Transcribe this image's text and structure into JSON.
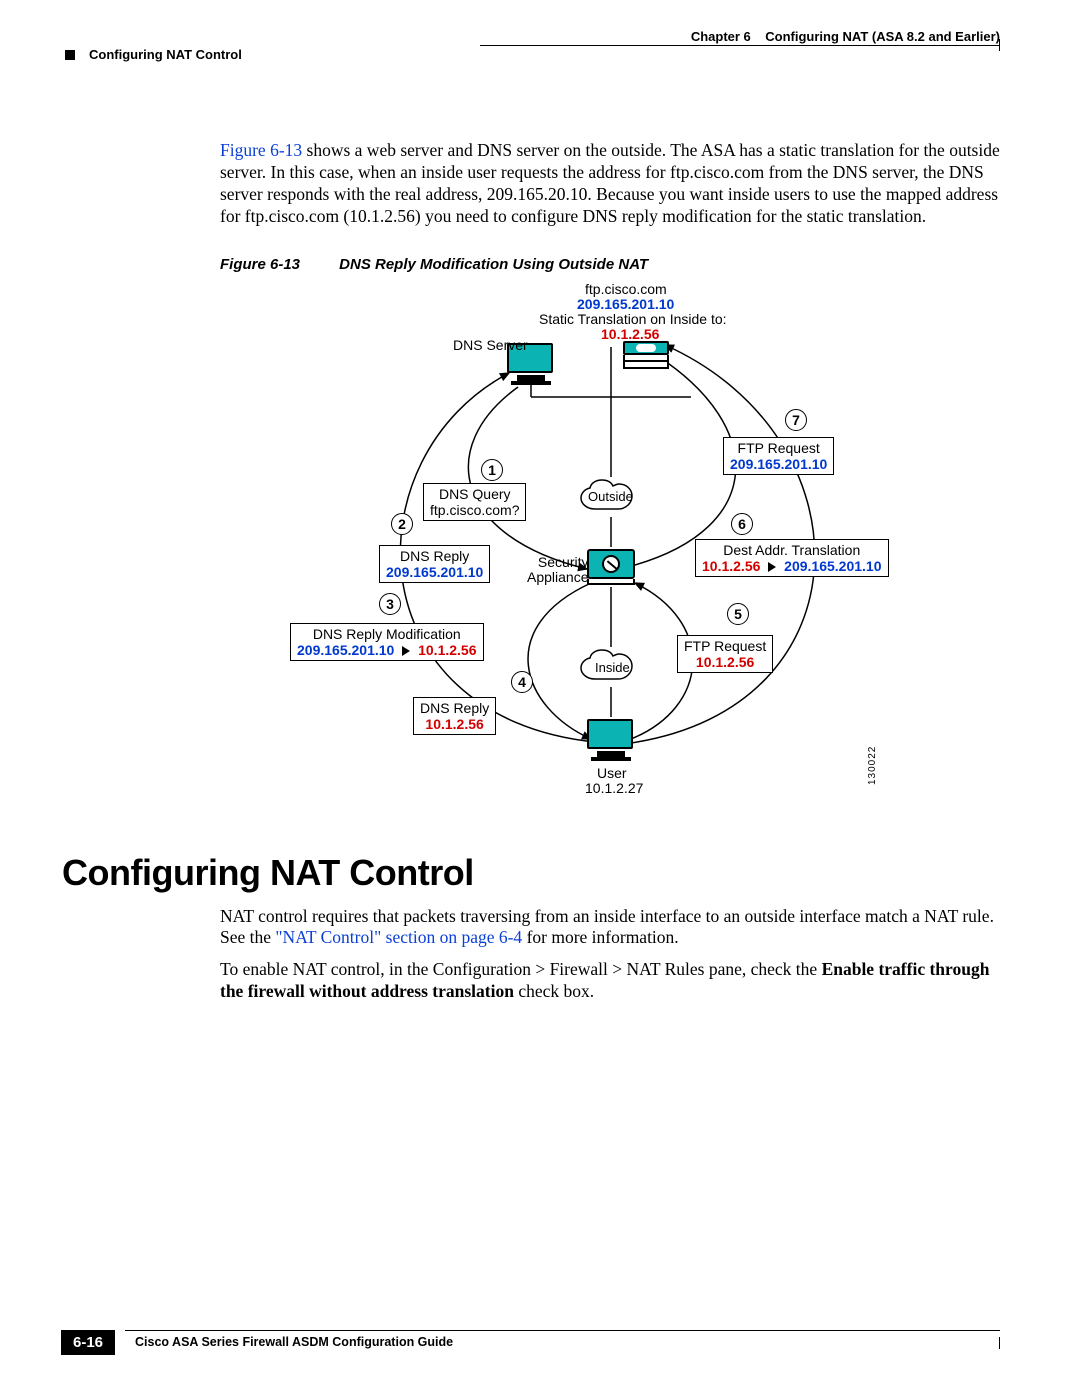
{
  "header": {
    "chapter": "Chapter 6",
    "chapter_title": "Configuring NAT (ASA 8.2 and Earlier)",
    "section": "Configuring NAT Control"
  },
  "intro": {
    "figref": "Figure 6-13",
    "text_after_ref": " shows a web server and DNS server on the outside. The ASA has a static translation for the outside server. In this case, when an inside user requests the address for ftp.cisco.com from the DNS server, the DNS server responds with the real address, 209.165.20.10. Because you want inside users to use the mapped address for ftp.cisco.com (10.1.2.56) you need to configure DNS reply modification for the static translation."
  },
  "figure": {
    "num": "Figure 6-13",
    "title": "DNS Reply Modification Using Outside NAT",
    "diagram_id": "130022",
    "labels": {
      "ftp_host": "ftp.cisco.com",
      "ftp_ip": "209.165.201.10",
      "static_xlate": "Static Translation on Inside to:",
      "static_ip": "10.1.2.56",
      "dns_server": "DNS Server",
      "outside": "Outside",
      "inside": "Inside",
      "sec_app": "Security\nAppliance",
      "user": "User",
      "user_ip": "10.1.2.27",
      "b1_l1": "DNS Query",
      "b1_l2": "ftp.cisco.com?",
      "b2_l1": "DNS Reply",
      "b2_ip": "209.165.201.10",
      "b3_l1": "DNS Reply Modification",
      "b3_from": "209.165.201.10",
      "b3_to": "10.1.2.56",
      "b4_l1": "DNS Reply",
      "b4_ip": "10.1.2.56",
      "b5_l1": "FTP Request",
      "b5_ip": "10.1.2.56",
      "b6_l1": "Dest Addr. Translation",
      "b6_from": "10.1.2.56",
      "b6_to": "209.165.201.10",
      "b7_l1": "FTP Request",
      "b7_ip": "209.165.201.10"
    }
  },
  "heading": "Configuring NAT Control",
  "p1_pre": "NAT control requires that packets traversing from an inside interface to an outside interface match a NAT rule. See the ",
  "p1_link": "\"NAT Control\" section on page 6-4",
  "p1_post": " for more information.",
  "p2_pre": "To enable NAT control, in the Configuration > Firewall > NAT Rules pane, check the ",
  "p2_bold": "Enable traffic through the firewall without address translation",
  "p2_post": " check box.",
  "footer": {
    "guide": "Cisco ASA Series Firewall ASDM Configuration Guide",
    "pagenum": "6-16"
  }
}
